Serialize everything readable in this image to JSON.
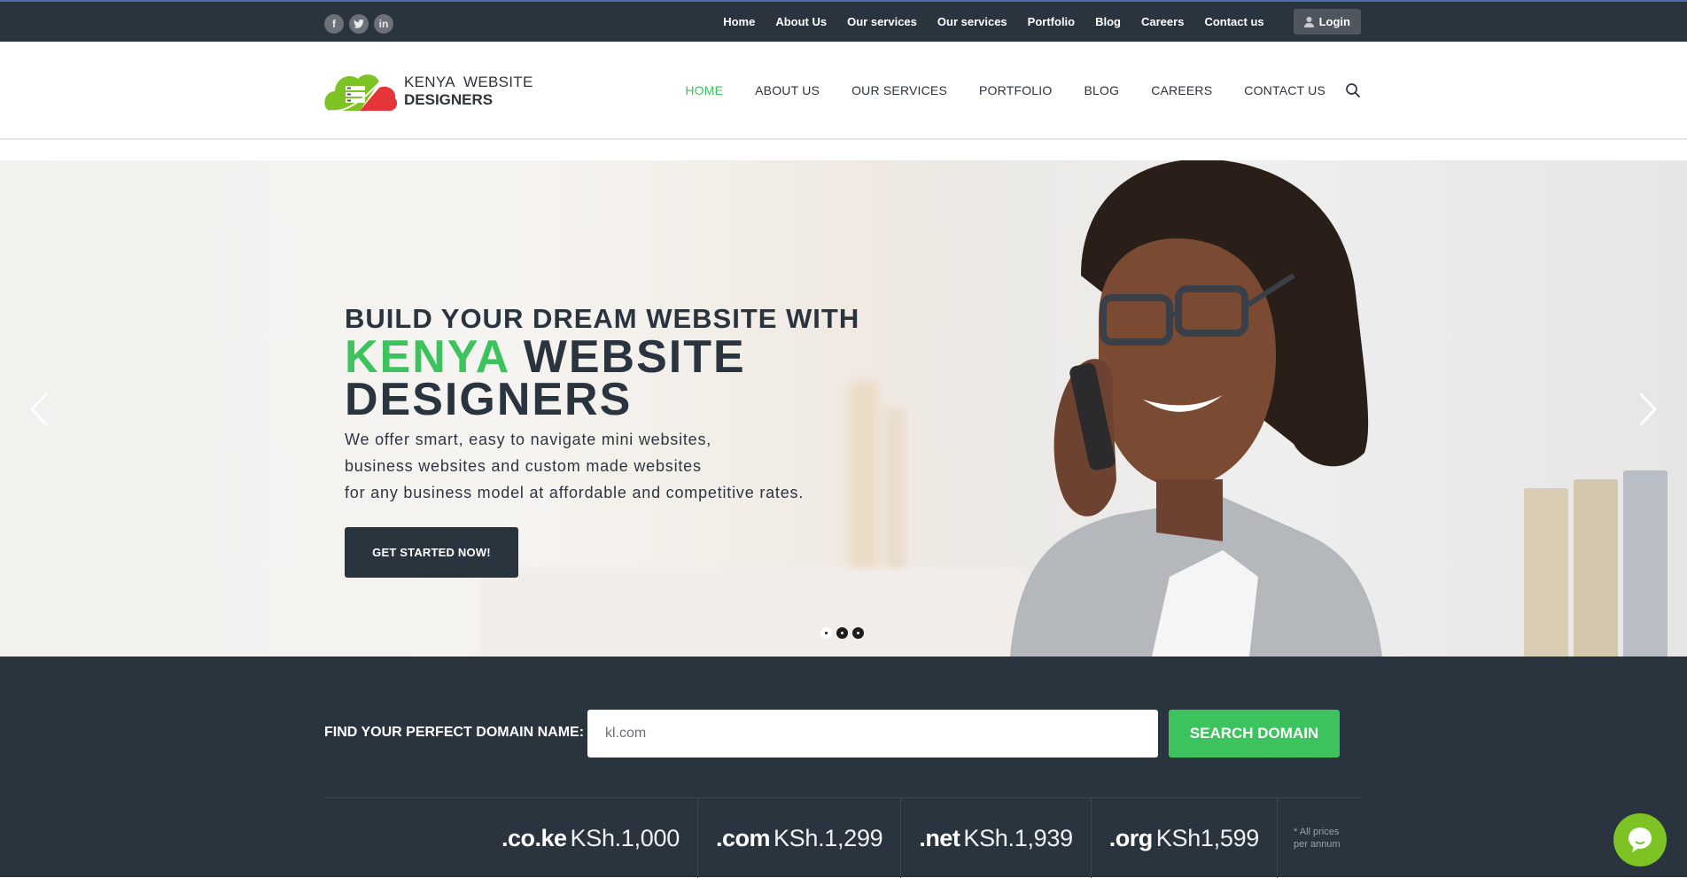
{
  "topbar": {
    "social": [
      {
        "icon": "facebook-icon",
        "glyph": "f"
      },
      {
        "icon": "twitter-icon",
        "glyph": "t"
      },
      {
        "icon": "linkedin-icon",
        "glyph": "in"
      }
    ],
    "links": [
      "Home",
      "About Us",
      "Our services",
      "Our services",
      "Portfolio",
      "Blog",
      "Careers",
      "Contact us"
    ],
    "login_label": "Login"
  },
  "header": {
    "logo_line1": "KENYA  WEBSITE",
    "logo_line2": "DESIGNERS",
    "nav": [
      {
        "label": "HOME",
        "active": true
      },
      {
        "label": "ABOUT US",
        "active": false
      },
      {
        "label": "OUR SERVICES",
        "active": false
      },
      {
        "label": "PORTFOLIO",
        "active": false
      },
      {
        "label": "BLOG",
        "active": false
      },
      {
        "label": "CAREERS",
        "active": false
      },
      {
        "label": "CONTACT US",
        "active": false
      }
    ]
  },
  "hero": {
    "line1": "BUILD YOUR DREAM WEBSITE WITH",
    "highlight": "KENYA",
    "line2_rest": " WEBSITE",
    "line3": "DESIGNERS",
    "desc": [
      "We offer smart, easy to navigate mini websites,",
      "business websites and custom made websites",
      "for any business model at affordable and competitive rates."
    ],
    "cta_label": "GET STARTED NOW!",
    "slides_total": 3,
    "active_slide": 1
  },
  "domain": {
    "label": "FIND YOUR PERFECT DOMAIN NAME:",
    "input_value": "kl.com",
    "button_label": "SEARCH DOMAIN",
    "prices": [
      {
        "tld": ".co.ke",
        "price": "KSh.1,000"
      },
      {
        "tld": ".com",
        "price": "KSh.1,299"
      },
      {
        "tld": ".net",
        "price": "KSh.1,939"
      },
      {
        "tld": ".org",
        "price": "KSh1,599"
      }
    ],
    "note_line1": "* All prices",
    "note_line2": "per annum"
  },
  "colors": {
    "dark": "#29343f",
    "accent_green": "#3cc35e",
    "chat_green": "#7ec324",
    "logo_red": "#e5353a"
  }
}
